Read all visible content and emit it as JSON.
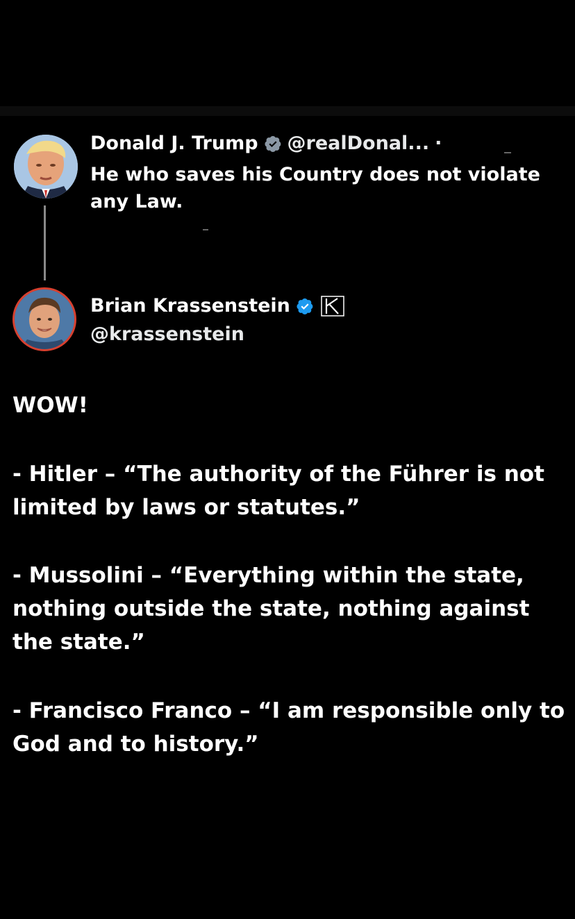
{
  "original_post": {
    "author_name": "Donald J. Trump",
    "author_handle": "@realDonal...",
    "separator": "·",
    "text_lines": [
      "He who saves his Country does not violate",
      "any Law."
    ]
  },
  "reply": {
    "author_name": "Brian Krassenstein",
    "author_handle": "@krassenstein",
    "text": {
      "line1": "WOW!",
      "hitler": [
        "- Hitler – “The authority of the Führer is not",
        "limited by laws or statutes.”"
      ],
      "mussolini": [
        "- Mussolini – “Everything within the state,",
        "nothing outside the state, nothing against",
        "the state.”"
      ],
      "franco": [
        "- Francisco Franco – “I am responsible only to",
        "God and to history.”"
      ]
    }
  },
  "icons": {
    "trump_badge": "verified-badge-gray-icon",
    "brian_badge": "verified-badge-blue-icon",
    "affiliate": "k-logo-icon"
  },
  "colors": {
    "background": "#000000",
    "text": "#ffffff",
    "verified_gray": "#8b98a5",
    "verified_blue": "#1d9bf0",
    "avatar_ring": "#d7402f",
    "thread_line": "#8a8a8a"
  }
}
